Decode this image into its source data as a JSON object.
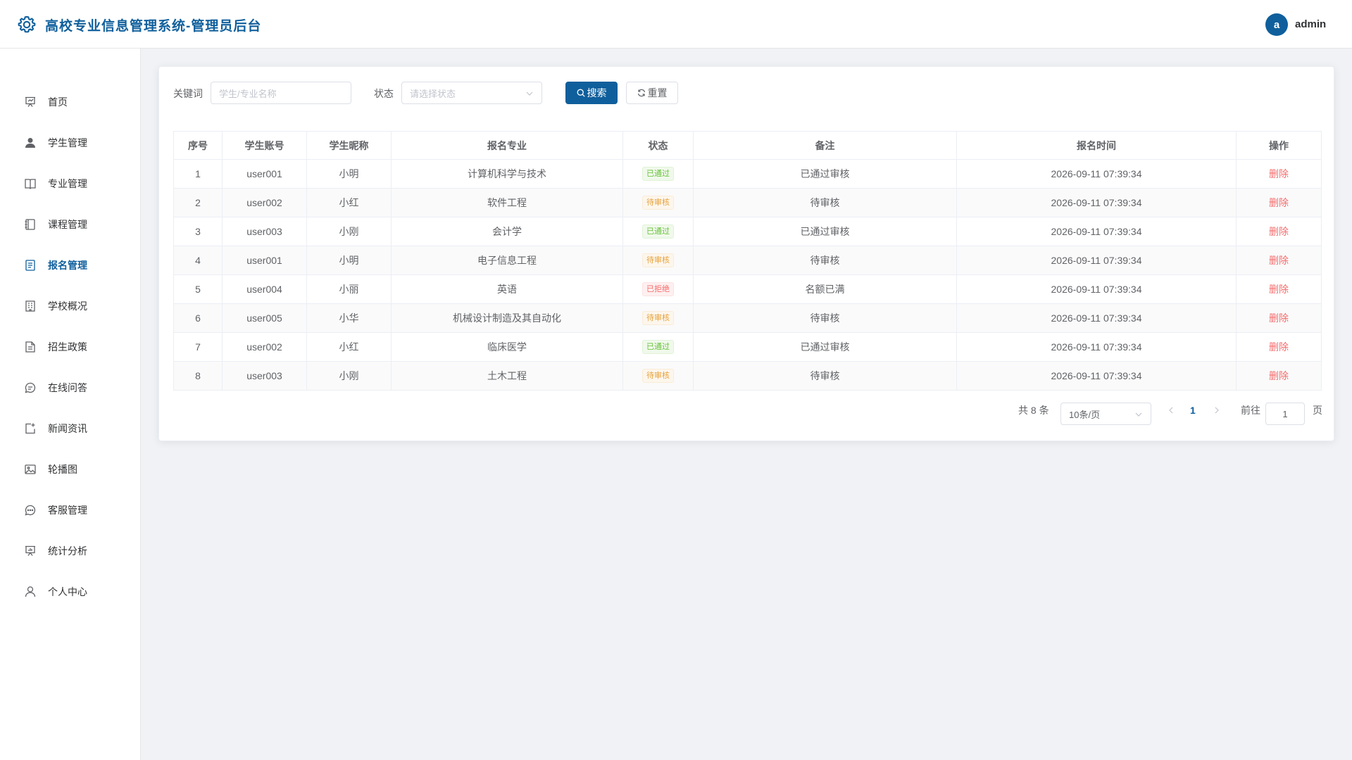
{
  "header": {
    "title": "高校专业信息管理系统-管理员后台",
    "avatar_letter": "a",
    "username": "admin"
  },
  "colors": {
    "brand": "#0f5f9c",
    "success": "#67c23a",
    "warning": "#e6a23c",
    "danger": "#f56c6c"
  },
  "sidebar": {
    "items": [
      {
        "label": "首页",
        "icon": "presentation-icon"
      },
      {
        "label": "学生管理",
        "icon": "user-filled-icon"
      },
      {
        "label": "专业管理",
        "icon": "book-icon"
      },
      {
        "label": "课程管理",
        "icon": "notebook-icon"
      },
      {
        "label": "报名管理",
        "icon": "document-icon",
        "active": true
      },
      {
        "label": "学校概况",
        "icon": "building-icon"
      },
      {
        "label": "招生政策",
        "icon": "file-icon"
      },
      {
        "label": "在线问答",
        "icon": "chat-icon"
      },
      {
        "label": "新闻资讯",
        "icon": "news-icon"
      },
      {
        "label": "轮播图",
        "icon": "picture-icon"
      },
      {
        "label": "客服管理",
        "icon": "chat-dots-icon"
      },
      {
        "label": "统计分析",
        "icon": "chart-icon"
      },
      {
        "label": "个人中心",
        "icon": "user-icon"
      }
    ]
  },
  "filters": {
    "keyword_label": "关键词",
    "keyword_placeholder": "学生/专业名称",
    "status_label": "状态",
    "status_placeholder": "请选择状态",
    "search_button": "搜索",
    "reset_button": "重置"
  },
  "table": {
    "columns": [
      "序号",
      "学生账号",
      "学生昵称",
      "报名专业",
      "状态",
      "备注",
      "报名时间",
      "操作"
    ],
    "rows": [
      {
        "index": "1",
        "account": "user001",
        "nickname": "小明",
        "major": "计算机科学与技术",
        "status": "已通过",
        "status_type": "success",
        "remark": "已通过审核",
        "time": "2026-09-11 07:39:34",
        "action": "删除"
      },
      {
        "index": "2",
        "account": "user002",
        "nickname": "小红",
        "major": "软件工程",
        "status": "待审核",
        "status_type": "warning",
        "remark": "待审核",
        "time": "2026-09-11 07:39:34",
        "action": "删除"
      },
      {
        "index": "3",
        "account": "user003",
        "nickname": "小刚",
        "major": "会计学",
        "status": "已通过",
        "status_type": "success",
        "remark": "已通过审核",
        "time": "2026-09-11 07:39:34",
        "action": "删除"
      },
      {
        "index": "4",
        "account": "user001",
        "nickname": "小明",
        "major": "电子信息工程",
        "status": "待审核",
        "status_type": "warning",
        "remark": "待审核",
        "time": "2026-09-11 07:39:34",
        "action": "删除"
      },
      {
        "index": "5",
        "account": "user004",
        "nickname": "小丽",
        "major": "英语",
        "status": "已拒绝",
        "status_type": "danger",
        "remark": "名额已满",
        "time": "2026-09-11 07:39:34",
        "action": "删除"
      },
      {
        "index": "6",
        "account": "user005",
        "nickname": "小华",
        "major": "机械设计制造及其自动化",
        "status": "待审核",
        "status_type": "warning",
        "remark": "待审核",
        "time": "2026-09-11 07:39:34",
        "action": "删除"
      },
      {
        "index": "7",
        "account": "user002",
        "nickname": "小红",
        "major": "临床医学",
        "status": "已通过",
        "status_type": "success",
        "remark": "已通过审核",
        "time": "2026-09-11 07:39:34",
        "action": "删除"
      },
      {
        "index": "8",
        "account": "user003",
        "nickname": "小刚",
        "major": "土木工程",
        "status": "待审核",
        "status_type": "warning",
        "remark": "待审核",
        "time": "2026-09-11 07:39:34",
        "action": "删除"
      }
    ]
  },
  "pagination": {
    "total_text": "共 8 条",
    "page_size": "10条/页",
    "current_page": "1",
    "goto_label": "前往",
    "goto_value": "1",
    "page_suffix": "页"
  }
}
